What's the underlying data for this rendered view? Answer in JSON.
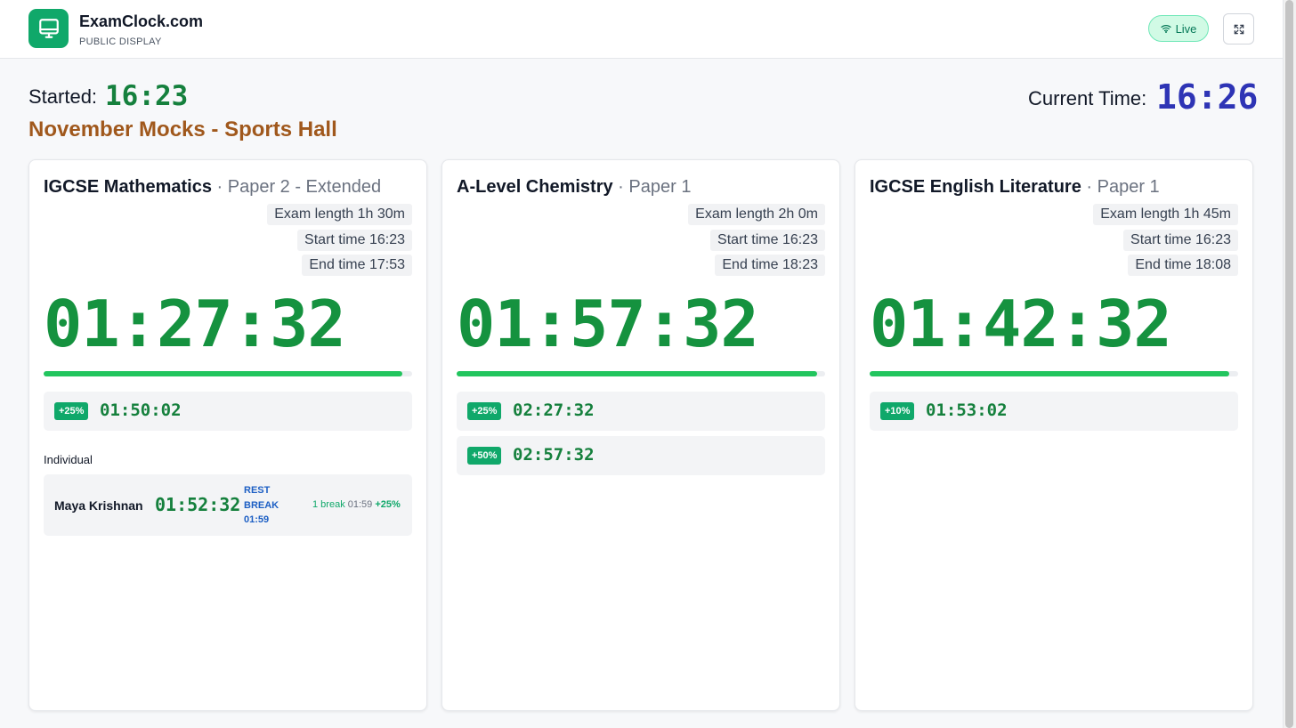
{
  "header": {
    "brand_title": "ExamClock.com",
    "brand_subtitle": "PUBLIC DISPLAY",
    "live_label": "Live",
    "logo_icon": "monitor-icon",
    "accent_color": "#10a86a"
  },
  "session": {
    "started_label": "Started:",
    "started_time": "16:23",
    "title": "November Mocks - Sports Hall",
    "current_label": "Current Time:",
    "current_time": "16:26"
  },
  "exams": [
    {
      "subject": "IGCSE Mathematics",
      "separator": " · ",
      "paper": "Paper 2 - Extended",
      "exam_length": "Exam length 1h 30m",
      "start_time": "Start time 16:23",
      "end_time": "End time 17:53",
      "countdown": "01:27:32",
      "progress": 0.973,
      "extra_time": [
        {
          "badge": "+25%",
          "time": "01:50:02"
        }
      ],
      "individual_label": "Individual",
      "individuals": [
        {
          "name": "Maya Krishnan",
          "time": "01:52:32",
          "status": "REST BREAK 01:59",
          "breaks": "1 break",
          "break_duration": "01:59",
          "extra": "+25%"
        }
      ]
    },
    {
      "subject": "A-Level Chemistry",
      "separator": " · ",
      "paper": "Paper 1",
      "exam_length": "Exam length 2h 0m",
      "start_time": "Start time 16:23",
      "end_time": "End time 18:23",
      "countdown": "01:57:32",
      "progress": 0.979,
      "extra_time": [
        {
          "badge": "+25%",
          "time": "02:27:32"
        },
        {
          "badge": "+50%",
          "time": "02:57:32"
        }
      ]
    },
    {
      "subject": "IGCSE English Literature",
      "separator": " · ",
      "paper": "Paper 1",
      "exam_length": "Exam length 1h 45m",
      "start_time": "Start time 16:23",
      "end_time": "End time 18:08",
      "countdown": "01:42:32",
      "progress": 0.976,
      "extra_time": [
        {
          "badge": "+10%",
          "time": "01:53:02"
        }
      ]
    }
  ]
}
